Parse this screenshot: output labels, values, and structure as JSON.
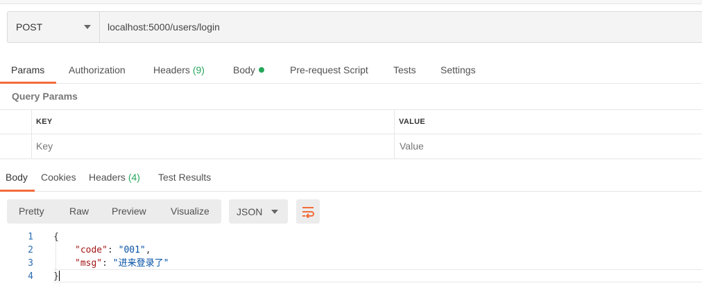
{
  "request": {
    "method": "POST",
    "url": "localhost:5000/users/login"
  },
  "request_tabs": [
    {
      "label": "Params",
      "active": true
    },
    {
      "label": "Authorization"
    },
    {
      "label": "Headers",
      "count": "(9)"
    },
    {
      "label": "Body",
      "indicator": "green-dot"
    },
    {
      "label": "Pre-request Script"
    },
    {
      "label": "Tests"
    },
    {
      "label": "Settings"
    }
  ],
  "query_params": {
    "title": "Query Params",
    "columns": [
      "KEY",
      "VALUE"
    ],
    "placeholders": {
      "key": "Key",
      "value": "Value"
    }
  },
  "response_tabs": [
    {
      "label": "Body",
      "active": true
    },
    {
      "label": "Cookies"
    },
    {
      "label": "Headers",
      "count": "(4)"
    },
    {
      "label": "Test Results"
    }
  ],
  "view_modes": [
    "Pretty",
    "Raw",
    "Preview",
    "Visualize"
  ],
  "format": "JSON",
  "wrap_icon": "wrap-lines-icon",
  "response_body": {
    "line_numbers": [
      "1",
      "2",
      "3",
      "4"
    ],
    "open_brace": "{",
    "close_brace": "}",
    "fields": [
      {
        "key": "\"code\"",
        "value": "\"001\"",
        "comma": ","
      },
      {
        "key": "\"msg\"",
        "value": "\"进来登录了\"",
        "comma": ""
      }
    ]
  },
  "colors": {
    "accent": "#f26b3a",
    "count_green": "#26a65b",
    "json_key": "#a31515",
    "json_string": "#0451a5",
    "line_number": "#2a6db3"
  }
}
